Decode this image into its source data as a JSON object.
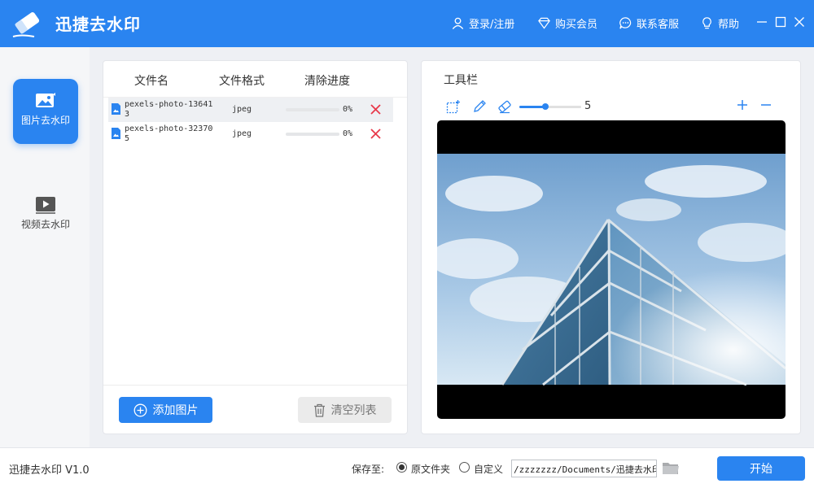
{
  "app": {
    "title": "迅捷去水印"
  },
  "nav": {
    "login": "登录/注册",
    "vip": "购买会员",
    "support": "联系客服",
    "help": "帮助"
  },
  "sidebar": {
    "items": [
      {
        "label": "图片去水印",
        "active": true
      },
      {
        "label": "视频去水印",
        "active": false
      }
    ]
  },
  "file_list": {
    "headers": {
      "name": "文件名",
      "format": "文件格式",
      "progress": "清除进度"
    },
    "rows": [
      {
        "name": "pexels-photo-136413",
        "format": "jpeg",
        "progress_pct": 0,
        "progress": "0%"
      },
      {
        "name": "pexels-photo-323705",
        "format": "jpeg",
        "progress_pct": 0,
        "progress": "0%"
      }
    ],
    "add_label": "添加图片",
    "clear_label": "清空列表"
  },
  "toolbar": {
    "title": "工具栏",
    "brush_size": "5",
    "brush_fraction": 0.42
  },
  "bottom": {
    "version": "迅捷去水印 V1.0",
    "save_label": "保存至:",
    "option_original": "原文件夹",
    "option_custom": "自定义",
    "path_value": "/zzzzzzz/Documents/迅捷去水印",
    "start_label": "开始"
  },
  "colors": {
    "accent": "#2a84f0",
    "delete": "#e8394b"
  },
  "icons": [
    "eraser-logo-icon",
    "user-icon",
    "diamond-icon",
    "chat-icon",
    "help-bulb-icon",
    "minimize-icon",
    "maximize-icon",
    "close-icon",
    "image-icon",
    "video-play-icon",
    "file-image-icon",
    "delete-x-icon",
    "plus-circle-icon",
    "trash-icon",
    "select-rect-icon",
    "pen-icon",
    "eraser-icon",
    "zoom-in-icon",
    "zoom-out-icon",
    "folder-icon"
  ]
}
